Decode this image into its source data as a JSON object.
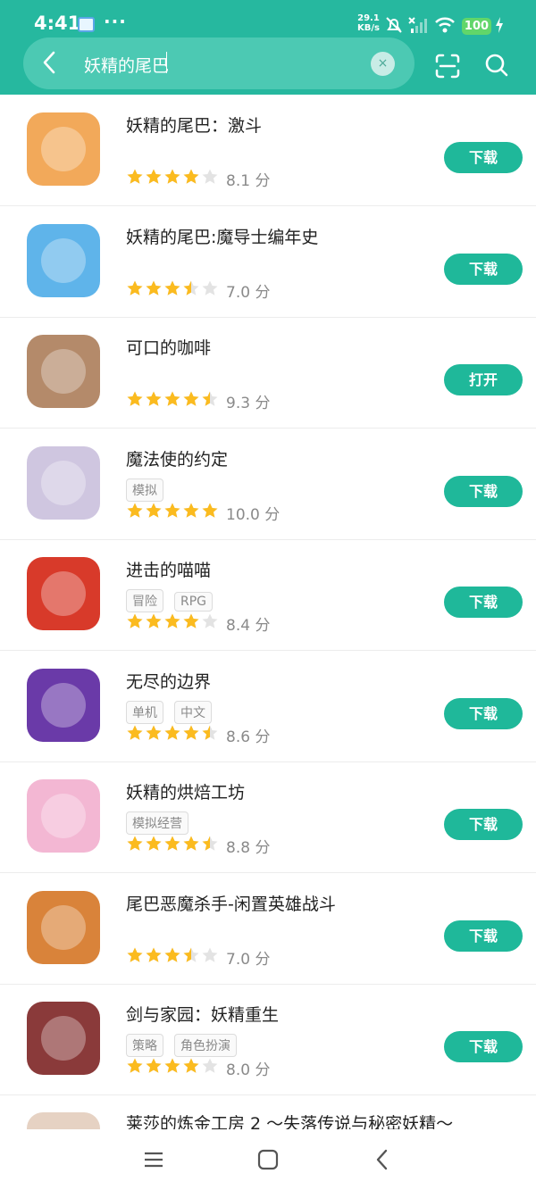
{
  "status": {
    "time": "4:41",
    "dots": "···",
    "net_speed_value": "29.1",
    "net_speed_unit": "KB/s",
    "battery": "100"
  },
  "search": {
    "query": "妖精的尾巴",
    "clear_label": "×"
  },
  "colors": {
    "header": "#26b89f",
    "button": "#1fb89a",
    "star_on": "#fbbb1f",
    "star_off": "#e3e3e3"
  },
  "results": [
    {
      "title": "妖精的尾巴：激斗",
      "tags": [],
      "rating": 4,
      "score": "8.1 分",
      "action": "下载",
      "icon": "fairy-tail-fight-icon",
      "color": "#f2a95a"
    },
    {
      "title": "妖精的尾巴:魔导士编年史",
      "tags": [],
      "rating": 3.5,
      "score": "7.0 分",
      "action": "下载",
      "icon": "fairy-tail-chronicle-icon",
      "color": "#5fb4ea"
    },
    {
      "title": "可口的咖啡",
      "tags": [],
      "rating": 4.5,
      "score": "9.3 分",
      "action": "打开",
      "icon": "coffee-icon",
      "color": "#b48a6a"
    },
    {
      "title": "魔法使的约定",
      "tags": [
        "模拟"
      ],
      "rating": 5,
      "score": "10.0 分",
      "action": "下载",
      "icon": "wizard-promise-icon",
      "color": "#cfc6e0"
    },
    {
      "title": "进击的喵喵",
      "tags": [
        "冒险",
        "RPG"
      ],
      "rating": 4,
      "score": "8.4 分",
      "action": "下载",
      "icon": "battle-cats-icon",
      "color": "#d83a2a"
    },
    {
      "title": "无尽的边界",
      "tags": [
        "单机",
        "中文"
      ],
      "rating": 4.5,
      "score": "8.6 分",
      "action": "下载",
      "icon": "endless-frontier-icon",
      "color": "#6a3aa8"
    },
    {
      "title": "妖精的烘焙工坊",
      "tags": [
        "模拟经营"
      ],
      "rating": 4.5,
      "score": "8.8 分",
      "action": "下载",
      "icon": "bakery-icon",
      "color": "#f3b7d3"
    },
    {
      "title": "尾巴恶魔杀手-闲置英雄战斗",
      "tags": [],
      "rating": 3.5,
      "score": "7.0 分",
      "action": "下载",
      "icon": "tail-demon-slayer-icon",
      "color": "#d9833a"
    },
    {
      "title": "剑与家园：妖精重生",
      "tags": [
        "策略",
        "角色扮演"
      ],
      "rating": 4,
      "score": "8.0 分",
      "action": "下载",
      "icon": "sword-home-icon",
      "color": "#8a3a3a"
    }
  ],
  "partial_result": {
    "title": "莱莎的炼金工房 2 ～失落传说与秘密妖精～"
  }
}
